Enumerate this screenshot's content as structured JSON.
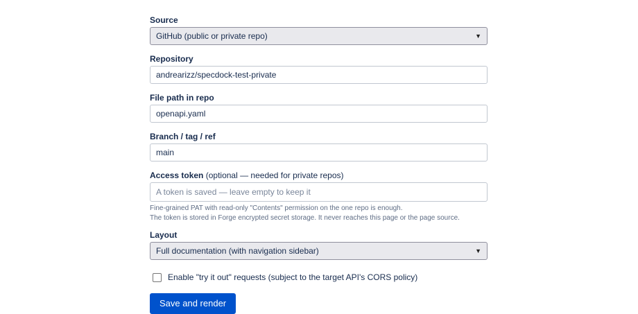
{
  "form": {
    "source": {
      "label": "Source",
      "value": "GitHub (public or private repo)"
    },
    "repository": {
      "label": "Repository",
      "value": "andrearizz/specdock-test-private"
    },
    "file_path": {
      "label": "File path in repo",
      "value": "openapi.yaml"
    },
    "branch": {
      "label": "Branch / tag / ref",
      "value": "main"
    },
    "access_token": {
      "label": "Access token",
      "label_optional": "(optional — needed for private repos)",
      "placeholder": "A token is saved — leave empty to keep it",
      "help_line_1": "Fine-grained PAT with read-only \"Contents\" permission on the one repo is enough.",
      "help_line_2": "The token is stored in Forge encrypted secret storage. It never reaches this page or the page source."
    },
    "layout": {
      "label": "Layout",
      "value": "Full documentation (with navigation sidebar)"
    },
    "try_it_out": {
      "label": "Enable \"try it out\" requests (subject to the target API's CORS policy)",
      "checked": false
    },
    "submit_label": "Save and render"
  },
  "icons": {
    "select_arrow": "chevron-down-icon"
  },
  "colors": {
    "primary_button": "#0052cc",
    "select_background": "#e9e9ed",
    "input_border": "#c1c7d0"
  }
}
